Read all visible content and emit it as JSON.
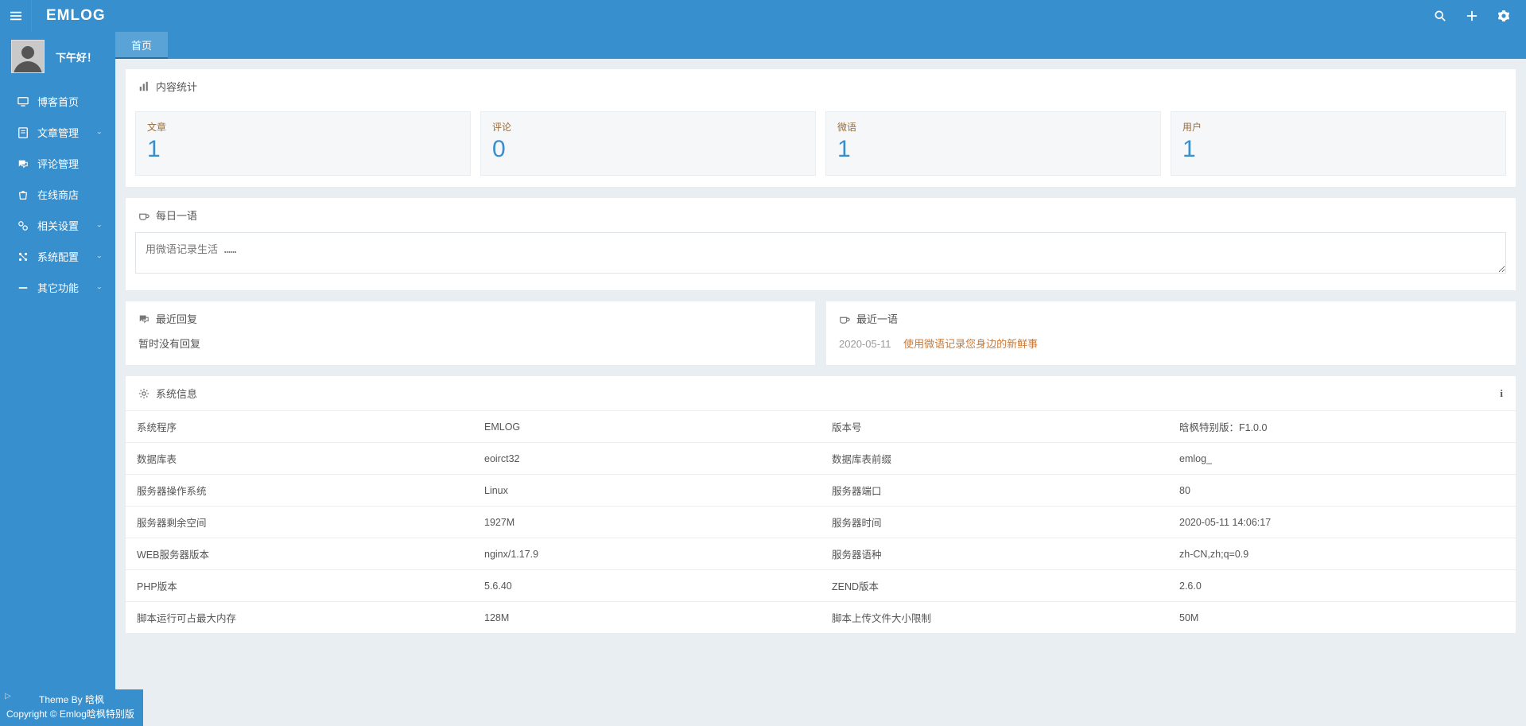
{
  "header": {
    "brand": "EMLOG"
  },
  "user": {
    "greeting": "下午好！"
  },
  "sidebar": {
    "items": [
      {
        "label": "博客首页",
        "expandable": false
      },
      {
        "label": "文章管理",
        "expandable": true
      },
      {
        "label": "评论管理",
        "expandable": false
      },
      {
        "label": "在线商店",
        "expandable": false
      },
      {
        "label": "相关设置",
        "expandable": true
      },
      {
        "label": "系统配置",
        "expandable": true
      },
      {
        "label": "其它功能",
        "expandable": true
      }
    ]
  },
  "footer": {
    "theme_by": "Theme By 晗枫",
    "copyright": "Copyright © Emlog晗枫特别版"
  },
  "tabs": {
    "home": "首页"
  },
  "panels": {
    "stats_title": "内容统计",
    "daily_title": "每日一语",
    "replies_title": "最近回复",
    "recent_title": "最近一语",
    "system_title": "系统信息"
  },
  "stats": [
    {
      "label": "文章",
      "value": "1"
    },
    {
      "label": "评论",
      "value": "0"
    },
    {
      "label": "微语",
      "value": "1"
    },
    {
      "label": "用户",
      "value": "1"
    }
  ],
  "daily": {
    "placeholder": "用微语记录生活 ……"
  },
  "replies": {
    "empty": "暂时没有回复"
  },
  "recent": [
    {
      "date": "2020-05-11",
      "text": "使用微语记录您身边的新鲜事"
    }
  ],
  "system_rows": [
    [
      "系统程序",
      "EMLOG",
      "版本号",
      "晗枫特别版：F1.0.0"
    ],
    [
      "数据库表",
      "eoirct32",
      "数据库表前缀",
      "emlog_"
    ],
    [
      "服务器操作系统",
      "Linux",
      "服务器端口",
      "80"
    ],
    [
      "服务器剩余空间",
      "1927M",
      "服务器时间",
      "2020-05-11 14:06:17"
    ],
    [
      "WEB服务器版本",
      "nginx/1.17.9",
      "服务器语种",
      "zh-CN,zh;q=0.9"
    ],
    [
      "PHP版本",
      "5.6.40",
      "ZEND版本",
      "2.6.0"
    ],
    [
      "脚本运行可占最大内存",
      "128M",
      "脚本上传文件大小限制",
      "50M"
    ]
  ]
}
